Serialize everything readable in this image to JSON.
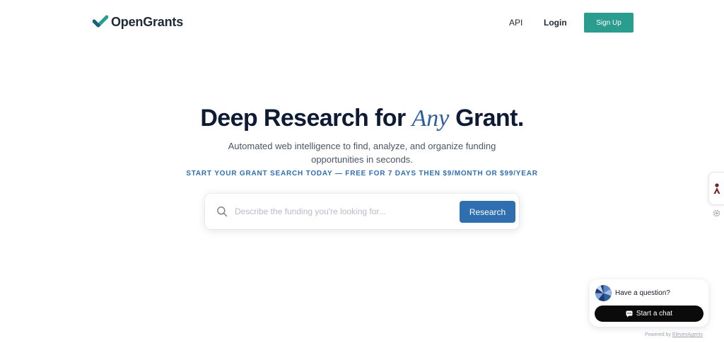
{
  "header": {
    "logo_text": "OpenGrants",
    "nav": {
      "api": "API",
      "login": "Login",
      "signup": "Sign Up"
    }
  },
  "hero": {
    "title_before": "Deep Research for ",
    "title_emphasis": "Any",
    "title_after": " Grant.",
    "subtitle": "Automated web intelligence to find, analyze, and organize funding opportunities in seconds.",
    "promo": "START YOUR GRANT SEARCH TODAY — FREE FOR 7 DAYS THEN $9/MONTH OR $99/YEAR"
  },
  "search": {
    "placeholder": "Describe the funding you're looking for...",
    "value": "",
    "button_label": "Research",
    "icon": "search-icon"
  },
  "chat_widget": {
    "question": "Have a question?",
    "button_label": "Start a chat",
    "powered_prefix": "Powered by ",
    "powered_link": "ElevenAgents"
  },
  "colors": {
    "brand_teal": "#2a9d8f",
    "accent_blue": "#2f6fb0",
    "title_navy": "#0f1b35"
  }
}
